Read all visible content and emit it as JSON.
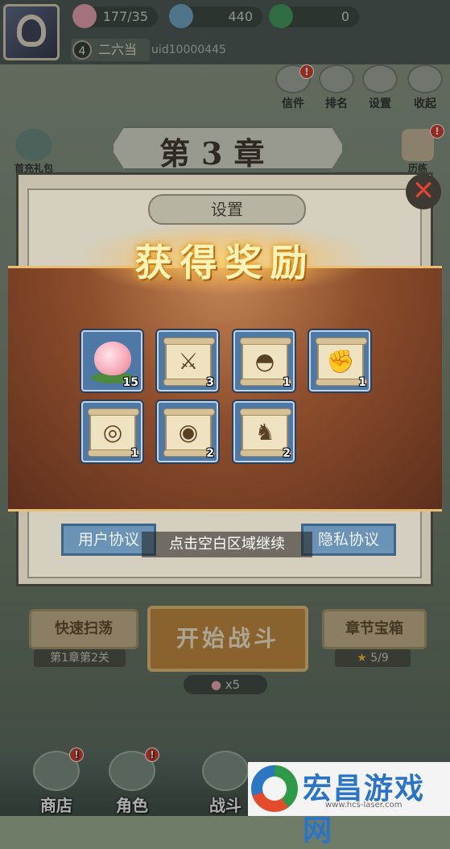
{
  "top_bar": {
    "resources": [
      {
        "icon": "peach-icon",
        "value": "177/35"
      },
      {
        "icon": "coin-icon",
        "value": "440"
      },
      {
        "icon": "jade-icon",
        "value": "0"
      }
    ],
    "level": "4",
    "player_name": "二六当",
    "uid": "uid10000445"
  },
  "top_menu": [
    {
      "label": "信件",
      "badge": "!"
    },
    {
      "label": "排名",
      "badge": ""
    },
    {
      "label": "设置",
      "badge": ""
    },
    {
      "label": "收起",
      "badge": ""
    }
  ],
  "chapter": {
    "title": "第3章",
    "help": "?"
  },
  "side": {
    "left_label": "首充礼包",
    "right_label": "历练",
    "right_badge": "!"
  },
  "settings_modal": {
    "title": "设置",
    "close": "✕",
    "user_agreement": "用户协议",
    "privacy_policy": "隐私协议"
  },
  "reward_popup": {
    "title": "获得奖励",
    "continue_hint": "点击空白区域继续",
    "items": [
      {
        "icon": "peach-icon",
        "glyph": "",
        "count": "15"
      },
      {
        "icon": "crossed-swords-scroll-icon",
        "glyph": "⚔",
        "count": "3"
      },
      {
        "icon": "fan-scroll-icon",
        "glyph": "◓",
        "count": "1"
      },
      {
        "icon": "fist-scroll-icon",
        "glyph": "✊",
        "count": "1"
      },
      {
        "icon": "necklace-scroll-icon",
        "glyph": "◎",
        "count": "1"
      },
      {
        "icon": "armor-scroll-icon",
        "glyph": "◉",
        "count": "2"
      },
      {
        "icon": "boot-scroll-icon",
        "glyph": "♞",
        "count": "2"
      }
    ]
  },
  "actions": {
    "sweep_label": "快速扫荡",
    "sweep_sub": "第1章第2关",
    "start_label": "开始战斗",
    "chest_label": "章节宝箱",
    "chest_progress": "5/9",
    "cost": "x5"
  },
  "nav": [
    {
      "label": "商店",
      "badge": "!"
    },
    {
      "label": "角色",
      "badge": "!"
    },
    {
      "label": "战斗",
      "badge": ""
    }
  ],
  "watermark": {
    "text": "宏昌游戏网",
    "url": "www.hcs-laser.com"
  }
}
